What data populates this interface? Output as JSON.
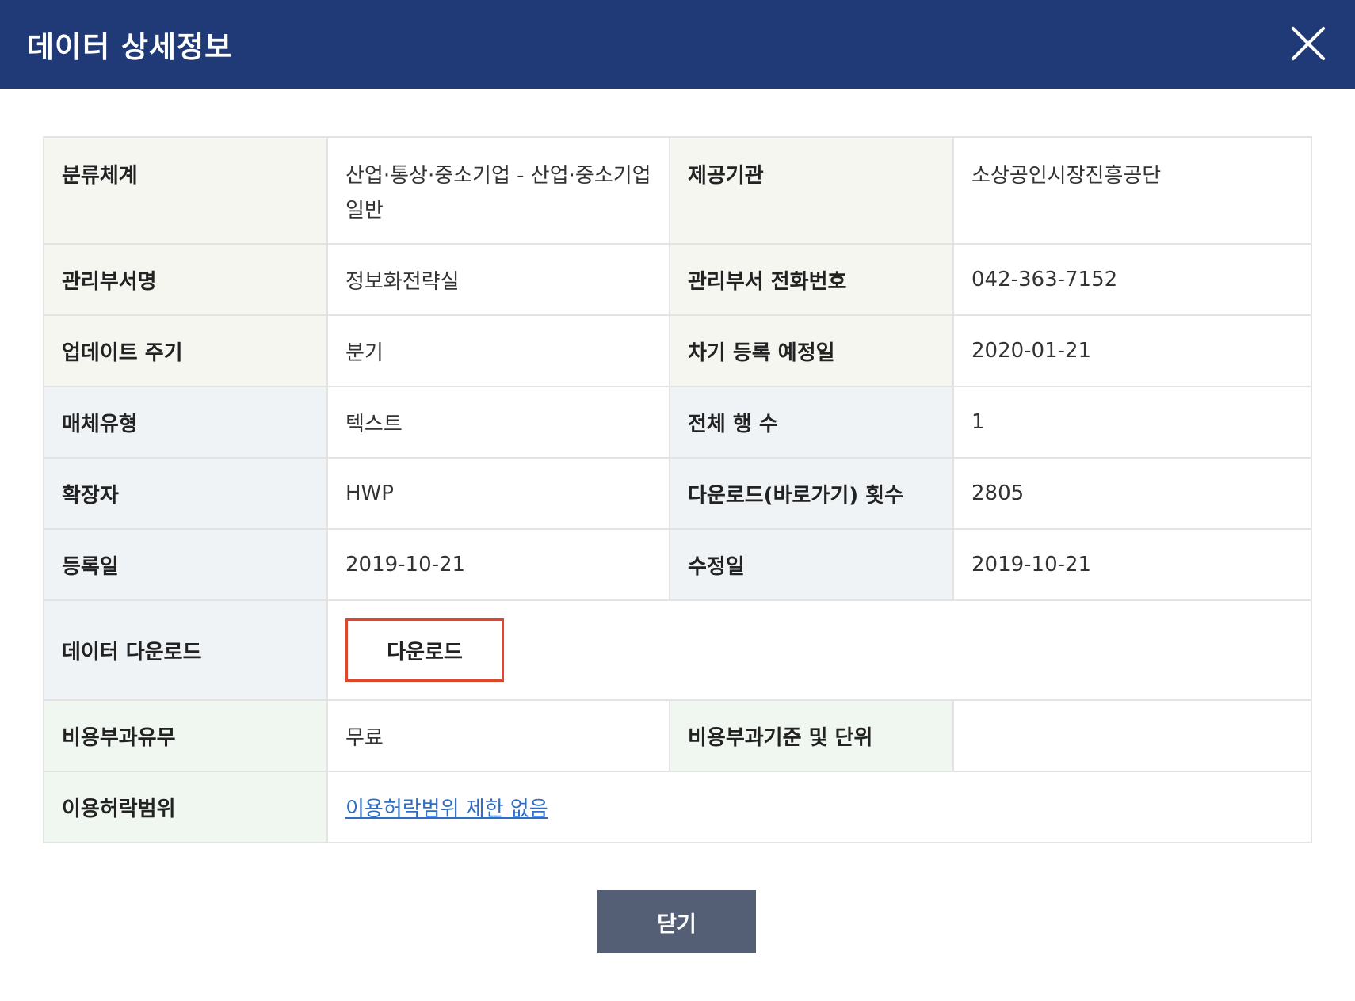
{
  "header": {
    "title": "데이터 상세정보"
  },
  "rows": [
    {
      "label1": "분류체계",
      "value1": "산업·통상·중소기업 - 산업·중소기업일반",
      "label2": "제공기관",
      "value2": "소상공인시장진흥공단"
    },
    {
      "label1": "관리부서명",
      "value1": "정보화전략실",
      "label2": "관리부서 전화번호",
      "value2": "042-363-7152"
    },
    {
      "label1": "업데이트 주기",
      "value1": "분기",
      "label2": "차기 등록 예정일",
      "value2": "2020-01-21"
    },
    {
      "label1": "매체유형",
      "value1": "텍스트",
      "label2": "전체 행 수",
      "value2": "1"
    },
    {
      "label1": "확장자",
      "value1": "HWP",
      "label2": "다운로드(바로가기) 횟수",
      "value2": "2805"
    },
    {
      "label1": "등록일",
      "value1": "2019-10-21",
      "label2": "수정일",
      "value2": "2019-10-21"
    }
  ],
  "download": {
    "label": "데이터 다운로드",
    "button": "다운로드"
  },
  "fee": {
    "label1": "비용부과유무",
    "value1": "무료",
    "label2": "비용부과기준 및 단위",
    "value2": ""
  },
  "license": {
    "label": "이용허락범위",
    "link": "이용허락범위 제한 없음"
  },
  "footer": {
    "close_button": "닫기"
  },
  "colors": {
    "header_bg": "#1f3a76",
    "highlight_border": "#e04530",
    "link": "#2f6ec4",
    "close_button_bg": "#545f76"
  }
}
